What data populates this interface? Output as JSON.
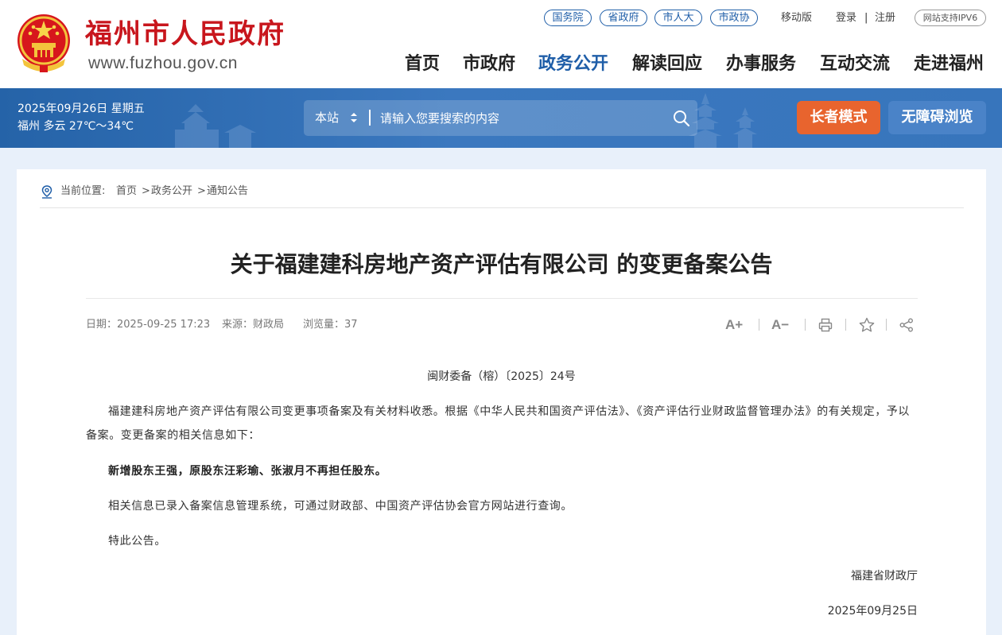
{
  "header": {
    "site_name": "福州市人民政府",
    "site_url": "www.fuzhou.gov.cn",
    "top_pills": [
      "国务院",
      "省政府",
      "市人大",
      "市政协"
    ],
    "mobile": "移动版",
    "login": "登录",
    "divider": "|",
    "register": "注册",
    "ipv6": "网站支持IPV6",
    "nav": [
      "首页",
      "市政府",
      "政务公开",
      "解读回应",
      "办事服务",
      "互动交流",
      "走进福州"
    ],
    "active_nav": "政务公开",
    "brand_color": "#c8161d",
    "accent_color": "#1f5ea8"
  },
  "banner": {
    "date": "2025年09月26日 星期五",
    "weather": "福州 多云 27℃～34℃",
    "search_scope": "本站",
    "search_placeholder": "请输入您要搜索的内容",
    "elder_mode": "长者模式",
    "accessibility": "无障碍浏览"
  },
  "breadcrumb": {
    "label": "当前位置:",
    "items": [
      "首页",
      "政务公开",
      "通知公告"
    ],
    "sep": ">"
  },
  "article": {
    "title": "关于福建建科房地产资产评估有限公司 的变更备案公告",
    "date": "日期：2025-09-25 17:23",
    "source": "来源：财政局",
    "views": "浏览量：37",
    "tools": [
      "A+",
      "A−",
      "print-icon",
      "star-icon",
      "share-icon"
    ],
    "doc_no": "闽财委备（榕）〔2025〕24号",
    "paragraphs": [
      "福建建科房地产资产评估有限公司变更事项备案及有关材料收悉。根据《中华人民共和国资产评估法》、《资产评估行业财政监督管理办法》的有关规定，予以备案。变更备案的相关信息如下：",
      "新增股东王强，原股东汪彩瑜、张淑月不再担任股东。",
      "相关信息已录入备案信息管理系统，可通过财政部、中国资产评估协会官方网站进行查询。",
      "特此公告。"
    ],
    "signature": "福建省财政厅",
    "sign_date": "2025年09月25日"
  }
}
